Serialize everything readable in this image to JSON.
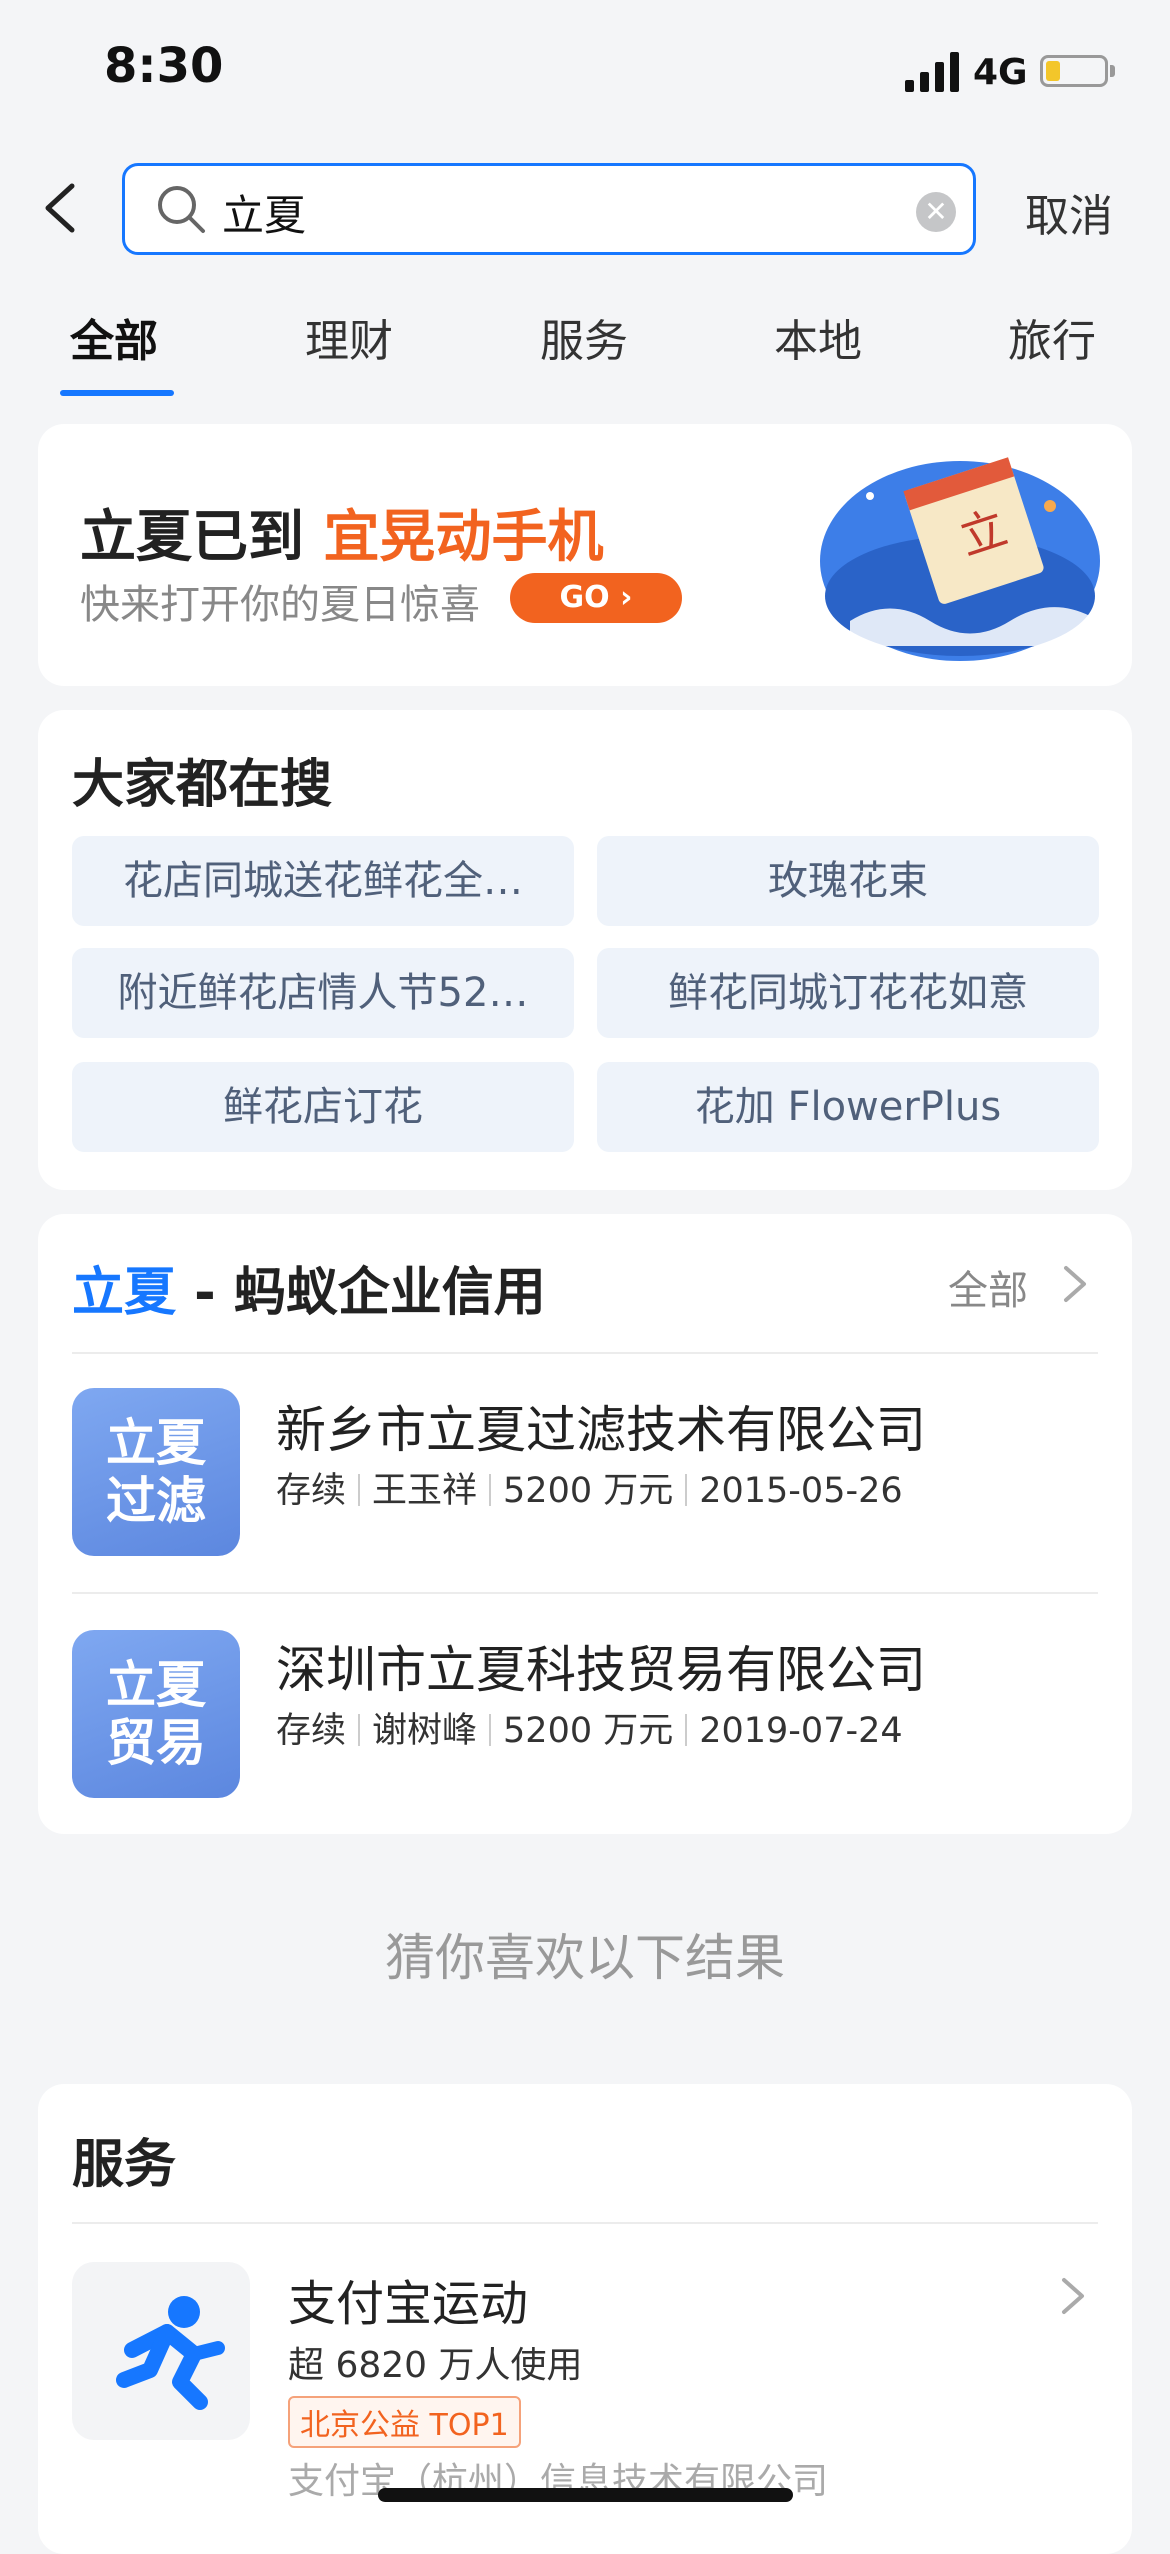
{
  "status_bar": {
    "time": "8:30",
    "network": "4G"
  },
  "search": {
    "query": "立夏",
    "cancel_label": "取消"
  },
  "tabs": [
    {
      "label": "全部",
      "active": true
    },
    {
      "label": "理财"
    },
    {
      "label": "服务"
    },
    {
      "label": "本地"
    },
    {
      "label": "旅行"
    }
  ],
  "banner": {
    "title_prefix": "立夏已到 ",
    "title_highlight": "宜晃动手机",
    "subtitle": "快来打开你的夏日惊喜",
    "go_label": "GO"
  },
  "hot_search": {
    "title": "大家都在搜",
    "items": [
      "花店同城送花鲜花全…",
      "玫瑰花束",
      "附近鲜花店情人节52…",
      "鲜花同城订花花如意",
      "鲜花店订花",
      "花加 FlowerPlus"
    ]
  },
  "credit": {
    "keyword": "立夏",
    "title_suffix": " - 蚂蚁企业信用",
    "all_label": "全部",
    "companies": [
      {
        "logo_line1": "立夏",
        "logo_line2": "过滤",
        "name": "新乡市立夏过滤技术有限公司",
        "status": "存续",
        "person": "王玉祥",
        "capital": "5200 万元",
        "date": "2015-05-26"
      },
      {
        "logo_line1": "立夏",
        "logo_line2": "贸易",
        "name": "深圳市立夏科技贸易有限公司",
        "status": "存续",
        "person": "谢树峰",
        "capital": "5200 万元",
        "date": "2019-07-24"
      }
    ]
  },
  "guess_label": "猜你喜欢以下结果",
  "services": {
    "title": "服务",
    "item": {
      "name": "支付宝运动",
      "users": "超 6820 万人使用",
      "tag": "北京公益 TOP1",
      "provider": "支付宝（杭州）信息技术有限公司"
    }
  },
  "colors": {
    "accent": "#1677ff",
    "orange": "#f2631f"
  }
}
